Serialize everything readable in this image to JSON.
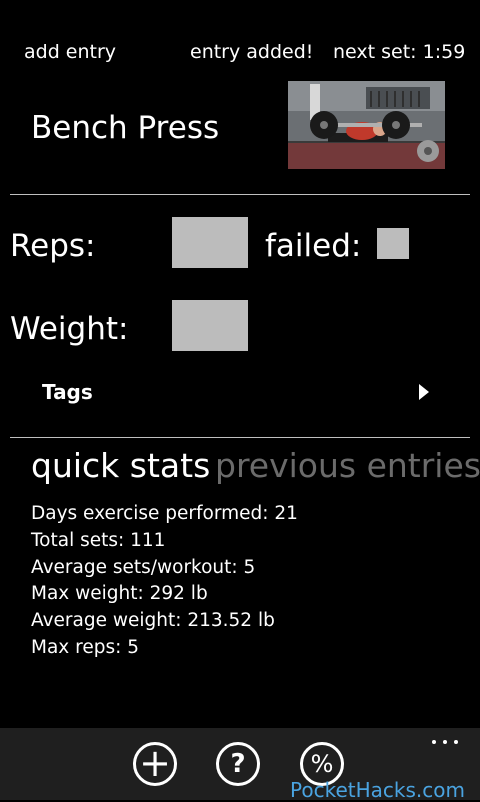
{
  "header": {
    "add_entry": "add entry",
    "status": "entry added!",
    "next_set": "next set: 1:59"
  },
  "exercise": {
    "title": "Bench Press",
    "photo_icon": "bench-press-photo"
  },
  "form": {
    "reps_label": "Reps:",
    "reps_value": "",
    "failed_label": "failed:",
    "failed_checked": false,
    "weight_label": "Weight:",
    "weight_value": "",
    "tags_label": "Tags"
  },
  "pivot": {
    "tabs": [
      {
        "label": "quick stats",
        "active": true
      },
      {
        "label": "previous entries",
        "active": false
      }
    ]
  },
  "stats": [
    "Days exercise performed: 21",
    "Total sets: 111",
    "Average sets/workout: 5",
    "Max weight: 292 lb",
    "Average weight: 213.52 lb",
    "Max reps: 5"
  ],
  "app_bar": {
    "add_icon": "+",
    "help_icon": "?",
    "stats_icon": "%",
    "more_icon": "more-icon"
  },
  "watermark": "PocketHacks.com",
  "colors": {
    "background": "#000000",
    "text": "#ffffff",
    "inactive_tab": "#6b6b6b",
    "input_fill": "#bcbcbc",
    "app_bar": "#1f1f1f",
    "watermark": "#4aa3e0"
  }
}
